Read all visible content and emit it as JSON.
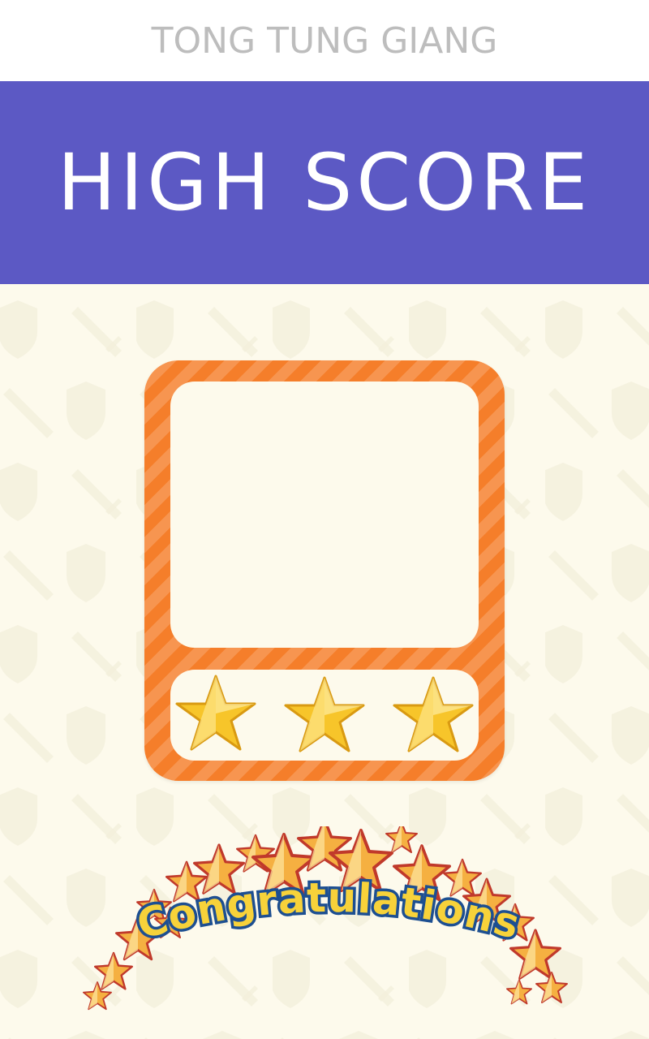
{
  "header": {
    "title": "TONG TUNG GIANG"
  },
  "banner": {
    "title": "HIGH SCORE"
  },
  "result": {
    "stars_earned": 3,
    "stars_total": 3
  },
  "congrats": {
    "text": "Congratulations"
  },
  "colors": {
    "banner": "#5c59c4",
    "card_orange": "#f57e2a",
    "background": "#fdfaec",
    "star_gold": "#f7c52a"
  }
}
